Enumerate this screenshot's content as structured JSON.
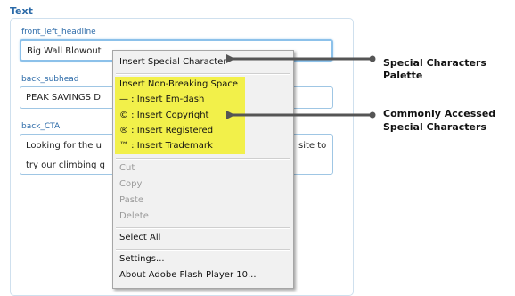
{
  "section_title": "Text",
  "fields": {
    "headline": {
      "label": "front_left_headline",
      "value": "Big Wall Blowout"
    },
    "subhead": {
      "label": "back_subhead",
      "value": "PEAK SAVINGS D"
    },
    "cta": {
      "label": "back_CTA",
      "value_start": "Looking for the u",
      "value_end": "site to",
      "value_line2": "try our climbing g"
    }
  },
  "context_menu": {
    "insert_special": "Insert Special Character",
    "highlighted_items": [
      "Insert Non-Breaking Space",
      "— : Insert Em-dash",
      "© : Insert Copyright",
      "® : Insert Registered",
      "™ : Insert Trademark"
    ],
    "edit_items": [
      "Cut",
      "Copy",
      "Paste",
      "Delete"
    ],
    "select_all": "Select All",
    "settings": "Settings...",
    "about": "About Adobe Flash Player 10..."
  },
  "callouts": {
    "palette": "Special Characters Palette",
    "common_line1": "Commonly Accessed",
    "common_line2": "Special Characters"
  },
  "colors": {
    "accent": "#2b6aa8",
    "highlight": "#f2f04a",
    "arrow": "#555555"
  }
}
